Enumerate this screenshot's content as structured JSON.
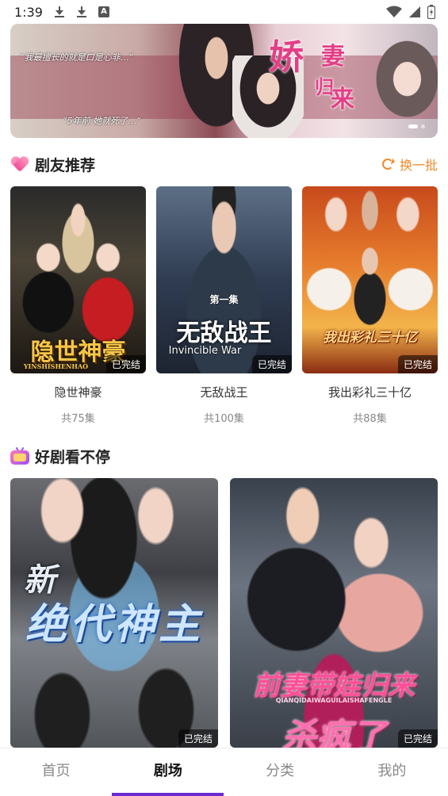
{
  "status_bar": {
    "time": "1:39",
    "icons": [
      "download-icon",
      "download-icon",
      "a-notification-icon",
      "wifi-icon",
      "signal-icon",
      "battery-icon"
    ]
  },
  "banner": {
    "quote_top": "“我最擅长的就是口是心非…”",
    "quote_bottom": "“5年前 她就死了…”",
    "title_1": "娇",
    "title_2": "妻",
    "title_3": "归",
    "title_4": "来",
    "page_count": 2,
    "active_page": 1
  },
  "recommend": {
    "title": "剧友推荐",
    "refresh_label": "换一批",
    "items": [
      {
        "poster_title": "隐世神豪",
        "poster_sub": "YINSHISHENHAO",
        "badge": "已完结",
        "name": "隐世神豪",
        "count": "共75集"
      },
      {
        "poster_title": "无敌战王",
        "poster_sub": "Invincible War",
        "poster_top": "第一集",
        "badge": "已完结",
        "name": "无敌战王",
        "count": "共100集"
      },
      {
        "poster_title": "我出彩礼三十亿",
        "badge": "已完结",
        "name": "我出彩礼三十亿",
        "count": "共88集"
      }
    ]
  },
  "nonstop": {
    "title": "好剧看不停",
    "items": [
      {
        "poster_tag": "新",
        "poster_title": "绝代神主",
        "badge": "已完结"
      },
      {
        "poster_title": "前妻带娃归来",
        "poster_sub": "QIANQIDAIWAGUILAISHAFENGLE",
        "poster_extra": "杀疯了",
        "badge": "已完结"
      }
    ]
  },
  "nav": {
    "items": [
      "首页",
      "剧场",
      "分类",
      "我的"
    ],
    "active_index": 1
  },
  "colors": {
    "accent": "#f08a2b",
    "nav_indicator": "#6a2bd0",
    "banner_title": "#e23f86"
  }
}
